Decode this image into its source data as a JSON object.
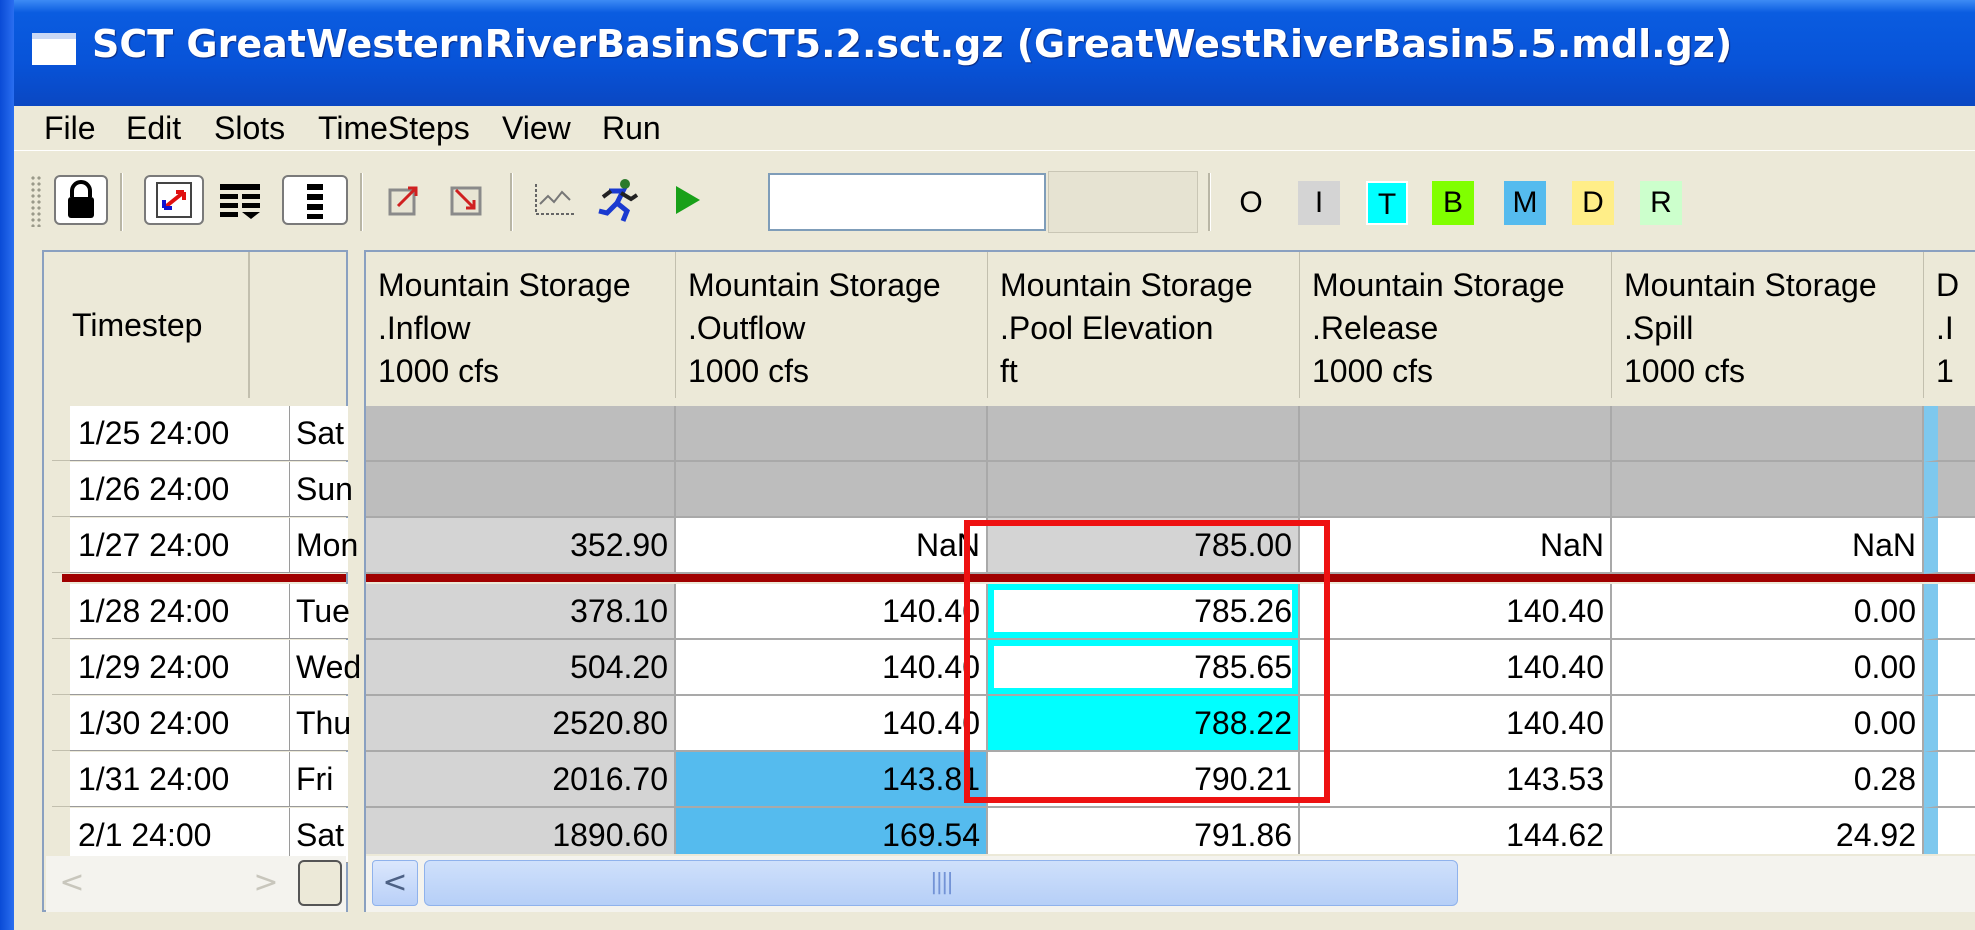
{
  "window": {
    "title": "SCT GreatWesternRiverBasinSCT5.2.sct.gz (GreatWestRiverBasin5.5.mdl.gz)"
  },
  "menu": {
    "items": [
      "File",
      "Edit",
      "Slots",
      "TimeSteps",
      "View",
      "Run"
    ]
  },
  "toolbar": {
    "color_buttons": [
      {
        "label": "O",
        "color": "#ffffff"
      },
      {
        "label": "I",
        "color": "#d4d4d4"
      },
      {
        "label": "T",
        "color": "#00ffff"
      },
      {
        "label": "B",
        "color": "#80ff00"
      },
      {
        "label": "M",
        "color": "#55bbee"
      },
      {
        "label": "D",
        "color": "#ffee88"
      },
      {
        "label": "R",
        "color": "#ccffcc"
      }
    ]
  },
  "table": {
    "timestep_header": "Timestep",
    "columns": [
      {
        "line1": "Mountain Storage",
        "line2": ".Inflow",
        "line3": "1000 cfs"
      },
      {
        "line1": "Mountain Storage",
        "line2": ".Outflow",
        "line3": "1000 cfs"
      },
      {
        "line1": "Mountain Storage",
        "line2": ".Pool Elevation",
        "line3": "ft"
      },
      {
        "line1": "Mountain Storage",
        "line2": ".Release",
        "line3": "1000 cfs"
      },
      {
        "line1": "Mountain Storage",
        "line2": ".Spill",
        "line3": "1000 cfs"
      },
      {
        "line1": "D",
        "line2": ".I",
        "line3": "1"
      }
    ],
    "rows": [
      {
        "date": "1/25 24:00",
        "day": "Sat",
        "values": [
          "",
          "",
          "",
          "",
          ""
        ]
      },
      {
        "date": "1/26 24:00",
        "day": "Sun",
        "values": [
          "",
          "",
          "",
          "",
          ""
        ]
      },
      {
        "date": "1/27 24:00",
        "day": "Mon",
        "values": [
          "352.90",
          "NaN",
          "785.00",
          "NaN",
          "NaN"
        ]
      },
      {
        "date": "1/28 24:00",
        "day": "Tue",
        "values": [
          "378.10",
          "140.40",
          "785.26",
          "140.40",
          "0.00"
        ]
      },
      {
        "date": "1/29 24:00",
        "day": "Wed",
        "values": [
          "504.20",
          "140.40",
          "785.65",
          "140.40",
          "0.00"
        ]
      },
      {
        "date": "1/30 24:00",
        "day": "Thu",
        "values": [
          "2520.80",
          "140.40",
          "788.22",
          "140.40",
          "0.00"
        ]
      },
      {
        "date": "1/31 24:00",
        "day": "Fri",
        "values": [
          "2016.70",
          "143.81",
          "790.21",
          "143.53",
          "0.28"
        ]
      },
      {
        "date": "2/1 24:00",
        "day": "Sat",
        "values": [
          "1890.60",
          "169.54",
          "791.86",
          "144.62",
          "24.92"
        ]
      }
    ]
  }
}
